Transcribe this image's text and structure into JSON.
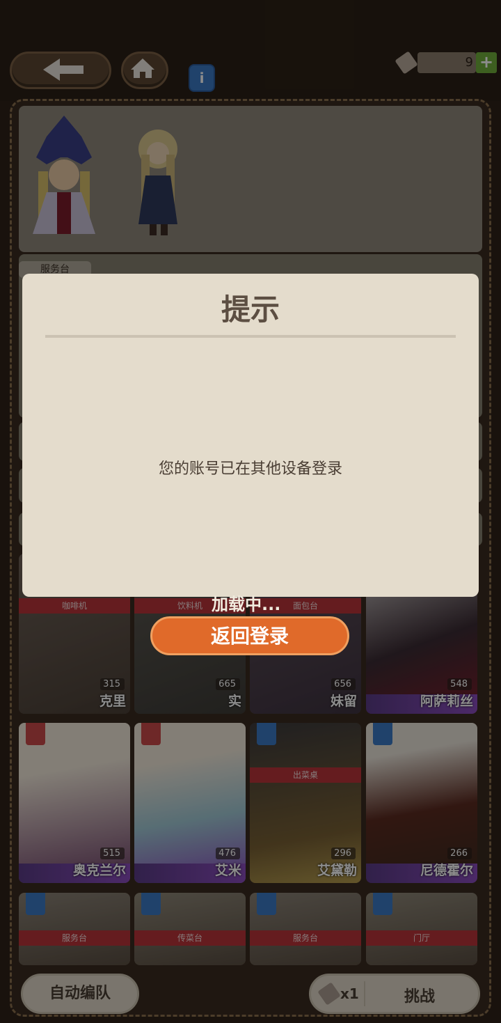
{
  "top_bar": {
    "ticket_count": "9",
    "plus_label": "+",
    "info_label": "i"
  },
  "panel": {
    "tag_service": "服务台"
  },
  "cards_row1": [
    {
      "role": "咖啡机",
      "level": "315",
      "name": "克里"
    },
    {
      "role": "饮料机",
      "level": "665",
      "name": "实"
    },
    {
      "role": "面包台",
      "level": "656",
      "name": "妹留"
    },
    {
      "role": "",
      "level": "548",
      "name": "阿萨莉丝"
    }
  ],
  "cards_row2": [
    {
      "role": "",
      "level": "515",
      "name": "奥克兰尔"
    },
    {
      "role": "",
      "level": "476",
      "name": "艾米"
    },
    {
      "role": "出菜桌",
      "level": "296",
      "name": "艾黛勒"
    },
    {
      "role": "",
      "level": "266",
      "name": "尼德霍尔"
    }
  ],
  "cards_row3": [
    {
      "role": "服务台"
    },
    {
      "role": "传菜台"
    },
    {
      "role": "服务台"
    },
    {
      "role": "门厅"
    }
  ],
  "dialog": {
    "title": "提示",
    "message": "您的账号已在其他设备登录"
  },
  "loading_text": "加载中...",
  "return_button": "返回登录",
  "bottom": {
    "auto_label": "自动编队",
    "ticket_multiplier": "x1",
    "challenge_label": "挑战"
  },
  "colors": {
    "accent_orange": "#e06a2a",
    "info_blue": "#3b78c4",
    "plus_green": "#6fae3b",
    "role_red": "#b8343a"
  }
}
